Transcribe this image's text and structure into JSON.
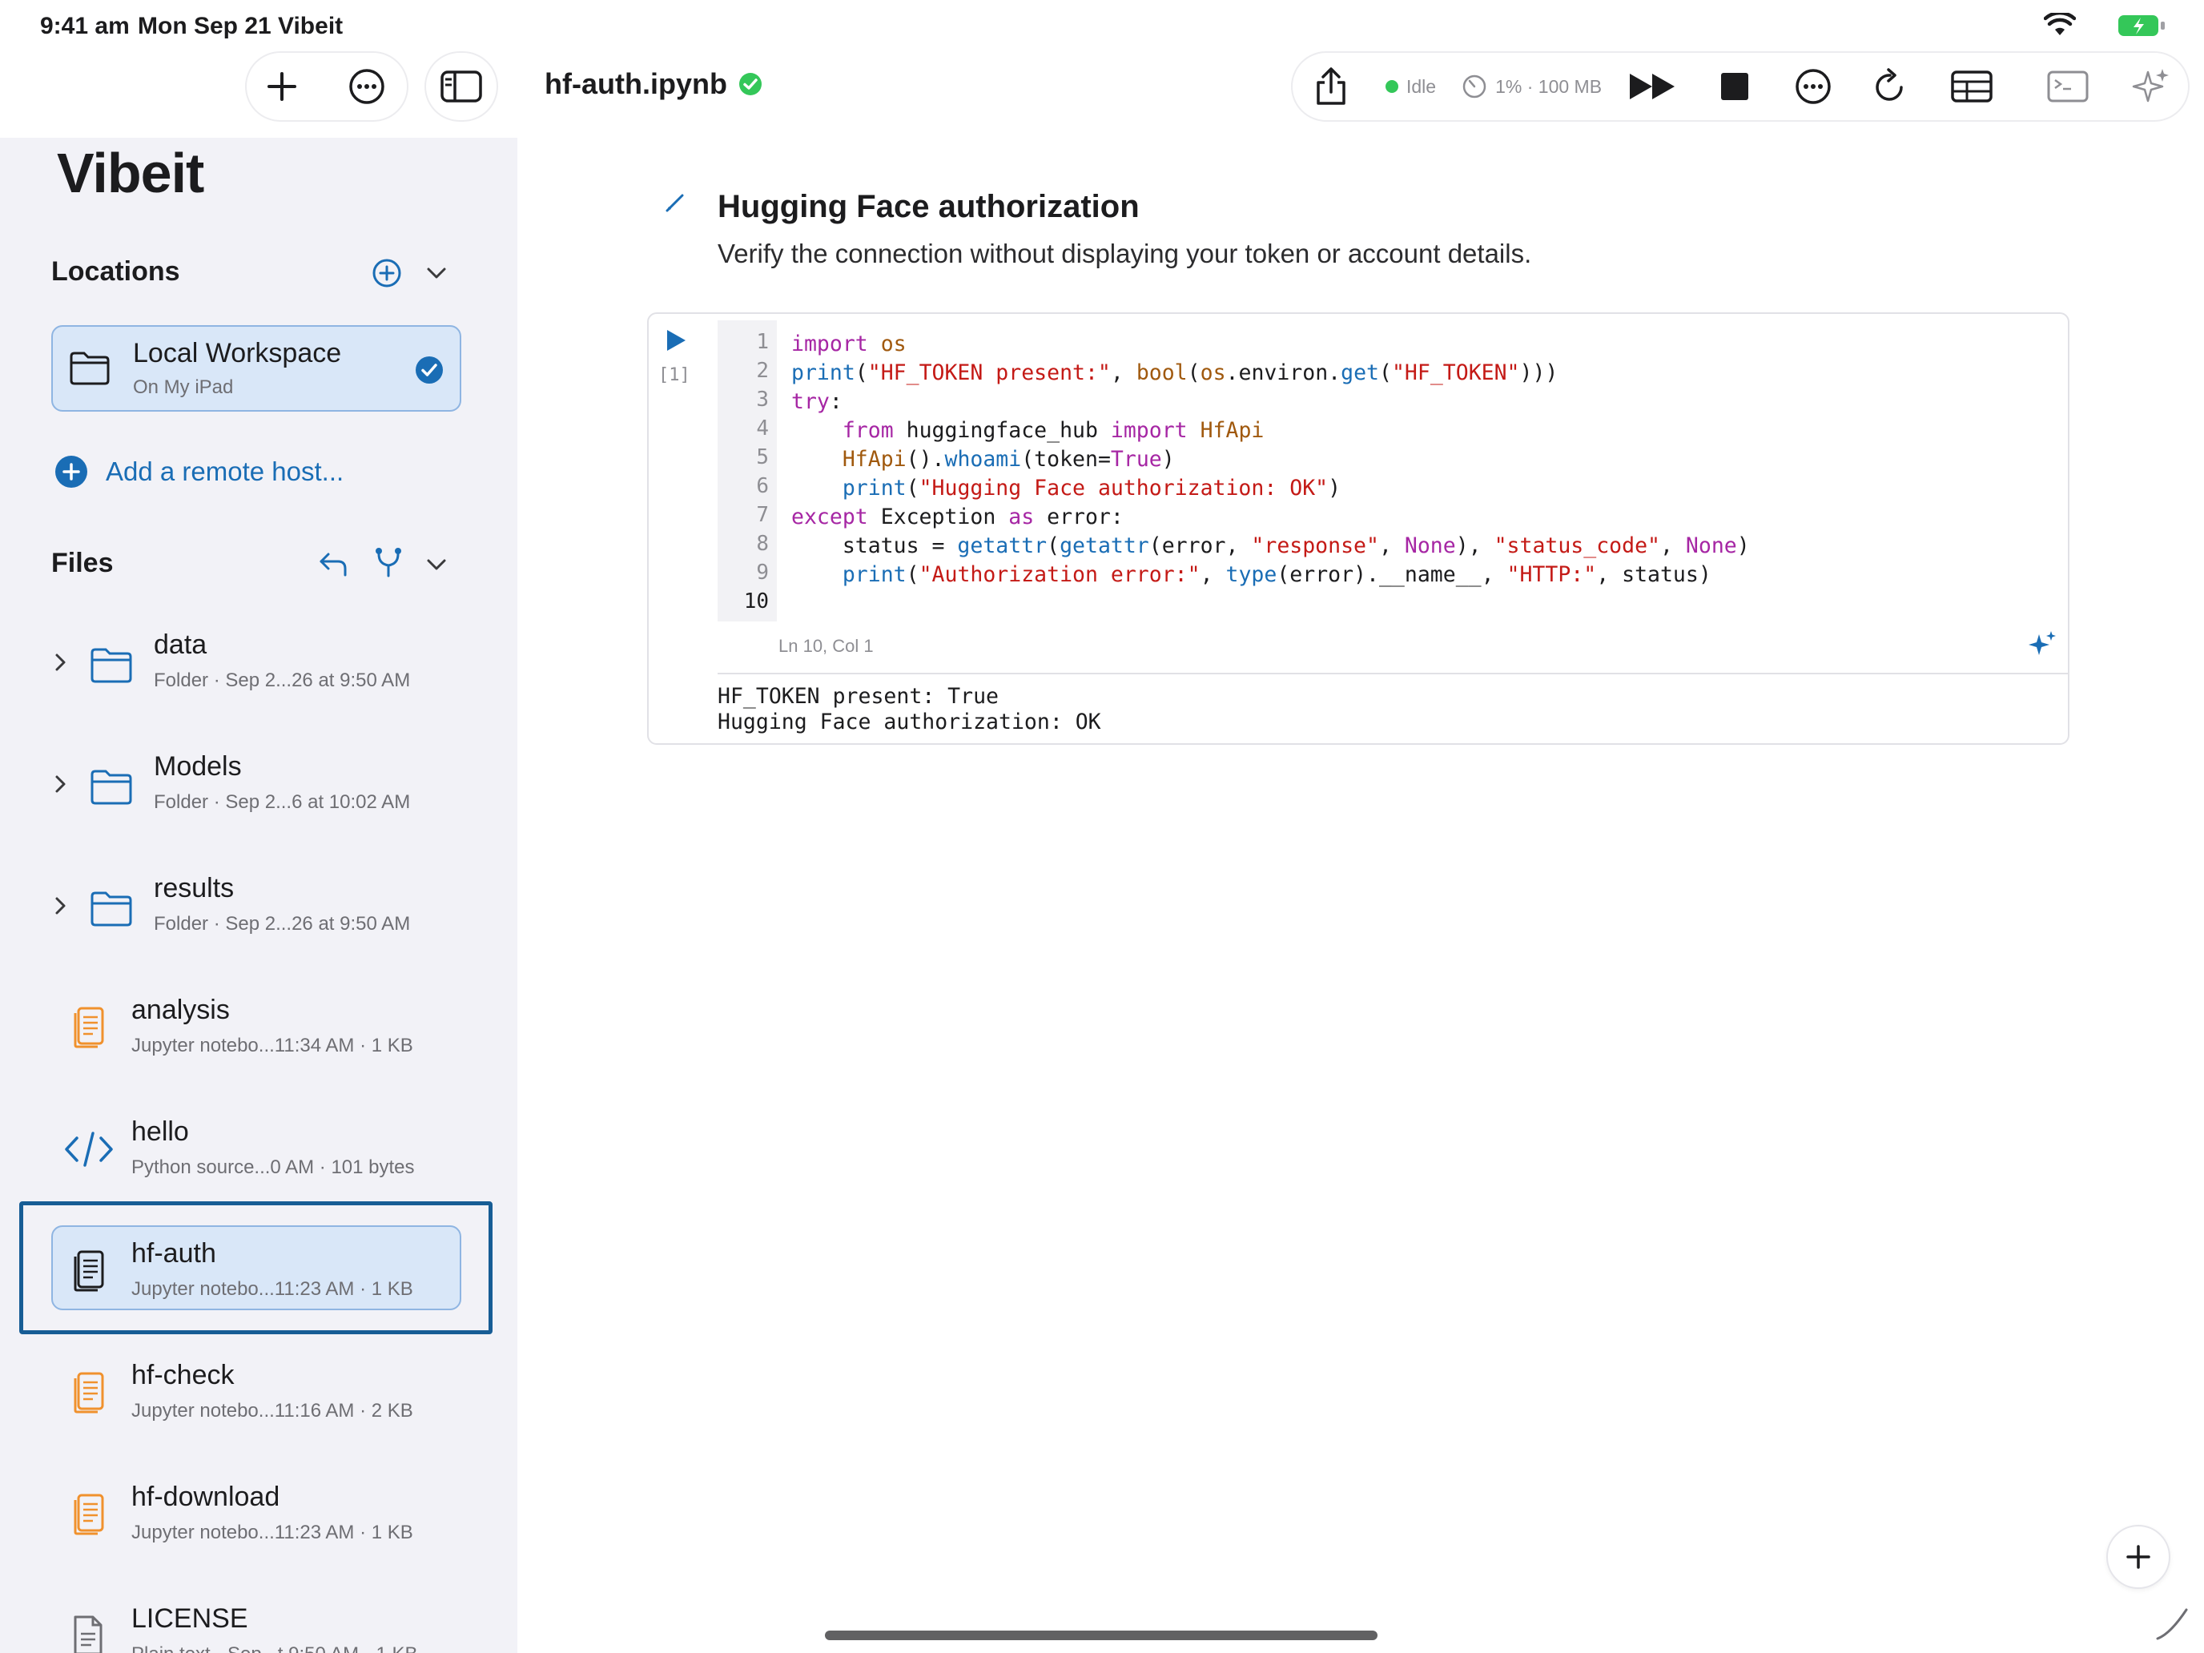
{
  "status_bar": {
    "time": "9:41 am",
    "date": "Mon Sep 21",
    "app": "Vibeit"
  },
  "toolbar": {
    "notebook_title": "hf-auth.ipynb",
    "kernel_status": "Idle",
    "resource_usage": "1% · 100 MB"
  },
  "sidebar": {
    "app_title": "Vibeit",
    "locations_label": "Locations",
    "location": {
      "name": "Local Workspace",
      "subtitle": "On My iPad"
    },
    "add_remote_label": "Add a remote host...",
    "files_label": "Files",
    "files": [
      {
        "name": "data",
        "meta": "Folder · Sep 2...26 at 9:50 AM",
        "type": "folder"
      },
      {
        "name": "Models",
        "meta": "Folder · Sep 2...6 at 10:02 AM",
        "type": "folder"
      },
      {
        "name": "results",
        "meta": "Folder · Sep 2...26 at 9:50 AM",
        "type": "folder"
      },
      {
        "name": "analysis",
        "meta": "Jupyter notebo...11:34 AM · 1 KB",
        "type": "notebook"
      },
      {
        "name": "hello",
        "meta": "Python source...0 AM · 101 bytes",
        "type": "python"
      },
      {
        "name": "hf-auth",
        "meta": "Jupyter notebo...11:23 AM · 1 KB",
        "type": "notebook-selected"
      },
      {
        "name": "hf-check",
        "meta": "Jupyter notebo...11:16 AM · 2 KB",
        "type": "notebook"
      },
      {
        "name": "hf-download",
        "meta": "Jupyter notebo...11:23 AM · 1 KB",
        "type": "notebook"
      },
      {
        "name": "LICENSE",
        "meta": "Plain text · Sep...t 9:50 AM · 1 KB",
        "type": "text"
      }
    ]
  },
  "notebook": {
    "markdown_title": "Hugging Face authorization",
    "markdown_subtitle": "Verify the connection without displaying your token or account details.",
    "execution_count": "[1]",
    "line_numbers": [
      "1",
      "2",
      "3",
      "4",
      "5",
      "6",
      "7",
      "8",
      "9",
      "10"
    ],
    "cursor_position": "Ln 10, Col 1",
    "output_lines": [
      "HF_TOKEN present: True",
      "Hugging Face authorization: OK"
    ]
  },
  "colors": {
    "accent": "#1a6db5",
    "selected_bg": "#d9e7f8",
    "kernel_idle": "#34c759",
    "notebook_icon": "#f0912d"
  },
  "icons": {
    "new": "plus-icon",
    "more": "ellipsis-circle-icon",
    "sidebar": "sidebar-toggle-icon",
    "share": "share-icon",
    "run_all": "fast-forward-icon",
    "stop": "stop-icon",
    "restart": "restart-icon",
    "variables": "table-icon",
    "terminal": "terminal-icon",
    "ai": "sparkles-icon"
  }
}
